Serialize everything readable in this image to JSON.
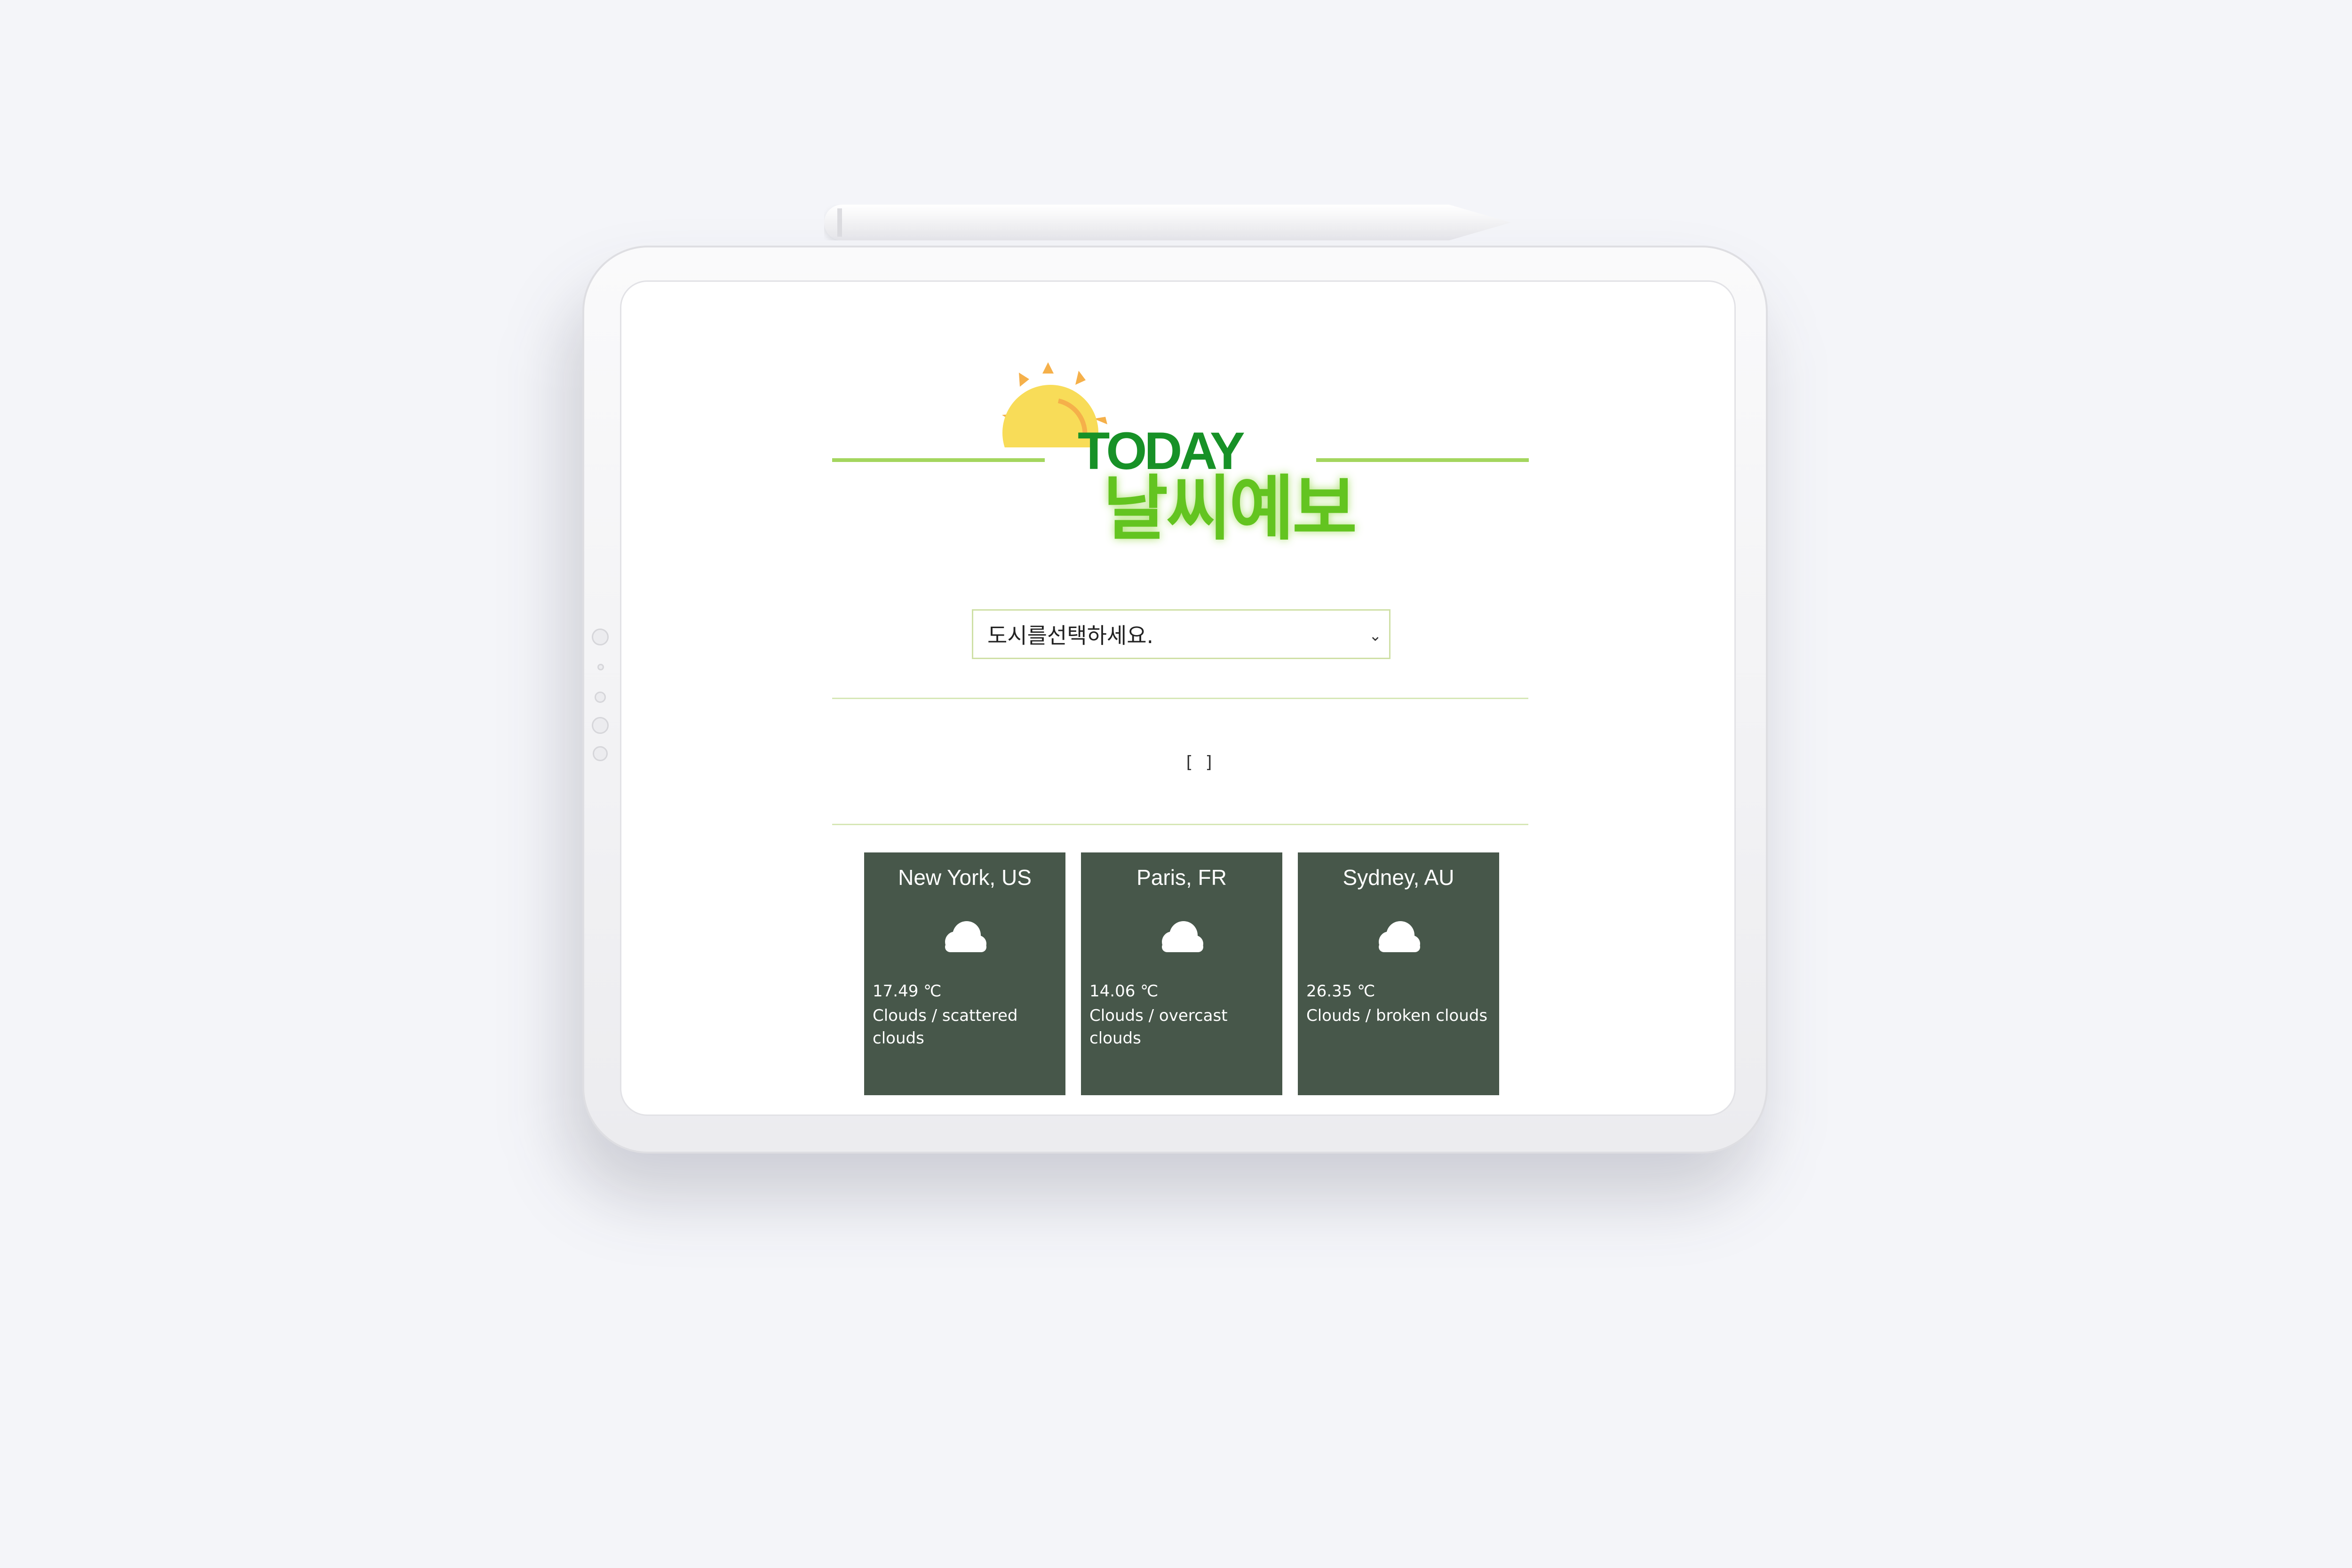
{
  "app": {
    "logo_today": "TODAY",
    "logo_korean": "날씨예보"
  },
  "city_select": {
    "placeholder": "도시를선택하세요."
  },
  "result_output": "[ ]",
  "weather_cards": [
    {
      "city": "New York, US",
      "temp": "17.49 ℃",
      "description": "Clouds / scattered clouds",
      "icon": "cloud-icon"
    },
    {
      "city": "Paris, FR",
      "temp": "14.06 ℃",
      "description": "Clouds / overcast clouds",
      "icon": "cloud-icon"
    },
    {
      "city": "Sydney, AU",
      "temp": "26.35 ℃",
      "description": "Clouds / broken clouds",
      "icon": "cloud-icon"
    }
  ],
  "colors": {
    "accent_green": "#179127",
    "logo_light_green": "#63c420",
    "card_background": "#47574a",
    "sun_yellow": "#f8dc58",
    "sun_ray_orange": "#f5b04a"
  }
}
